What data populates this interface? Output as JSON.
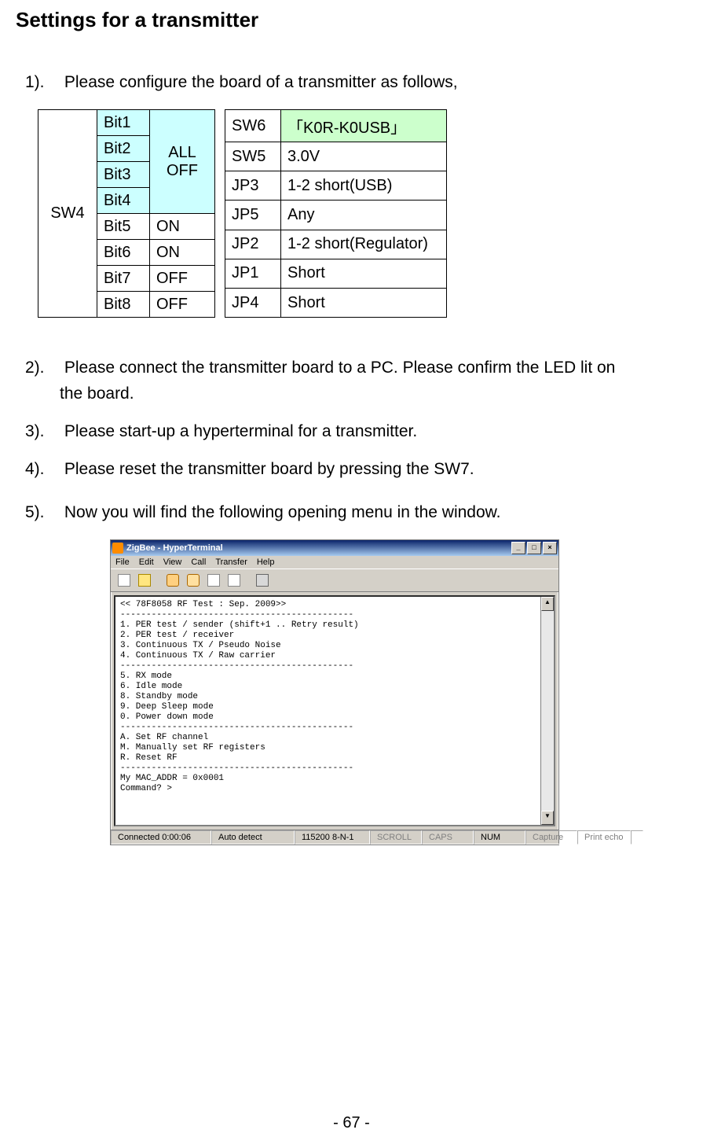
{
  "title": "Settings for a transmitter",
  "steps": {
    "s1_num": "1).",
    "s1_text": "Please configure the board of a transmitter as follows,",
    "s2_num": "2).",
    "s2_text": "Please connect the transmitter board to a PC. Please confirm the LED lit on",
    "s2_text2": "the board.",
    "s3_num": "3).",
    "s3_text": "Please start-up a hyperterminal for a transmitter.",
    "s4_num": "4).",
    "s4_text": "Please reset the transmitter board by pressing the SW7.",
    "s5_num": "5).",
    "s5_text": "Now you will find the following opening menu in the window."
  },
  "table1": {
    "rowlabel": "SW4",
    "rows": [
      {
        "bit": "Bit1"
      },
      {
        "bit": "Bit2"
      },
      {
        "bit": "Bit3"
      },
      {
        "bit": "Bit4"
      },
      {
        "bit": "Bit5",
        "val": "ON"
      },
      {
        "bit": "Bit6",
        "val": "ON"
      },
      {
        "bit": "Bit7",
        "val": "OFF"
      },
      {
        "bit": "Bit8",
        "val": "OFF"
      }
    ],
    "alloff_line1": "ALL",
    "alloff_line2": "OFF"
  },
  "table2": {
    "rows": [
      {
        "k": "SW6",
        "v": "「K0R-K0USB」",
        "hl": true
      },
      {
        "k": "SW5",
        "v": "3.0V"
      },
      {
        "k": "JP3",
        "v": "1-2 short(USB)"
      },
      {
        "k": "JP5",
        "v": "Any"
      },
      {
        "k": "JP2",
        "v": "1-2 short(Regulator)"
      },
      {
        "k": "JP1",
        "v": "Short"
      },
      {
        "k": "JP4",
        "v": "Short"
      }
    ]
  },
  "terminal": {
    "title": "ZigBee - HyperTerminal",
    "menu": {
      "file": "File",
      "edit": "Edit",
      "view": "View",
      "call": "Call",
      "transfer": "Transfer",
      "help": "Help"
    },
    "winbtns": {
      "min": "_",
      "max": "□",
      "close": "×"
    },
    "body": "<< 78F8058 RF Test : Sep. 2009>>\n---------------------------------------------\n1. PER test / sender (shift+1 .. Retry result)\n2. PER test / receiver\n3. Continuous TX / Pseudo Noise\n4. Continuous TX / Raw carrier\n---------------------------------------------\n5. RX mode\n6. Idle mode\n8. Standby mode\n9. Deep Sleep mode\n0. Power down mode\n---------------------------------------------\nA. Set RF channel\nM. Manually set RF registers\nR. Reset RF\n---------------------------------------------\nMy MAC_ADDR = 0x0001\nCommand? >",
    "status": {
      "connected": "Connected 0:00:06",
      "detect": "Auto detect",
      "setting": "115200 8-N-1",
      "scroll": "SCROLL",
      "caps": "CAPS",
      "num": "NUM",
      "capture": "Capture",
      "printecho": "Print echo"
    },
    "scroll": {
      "up": "▲",
      "down": "▼"
    }
  },
  "pagenum": "- 67 -"
}
